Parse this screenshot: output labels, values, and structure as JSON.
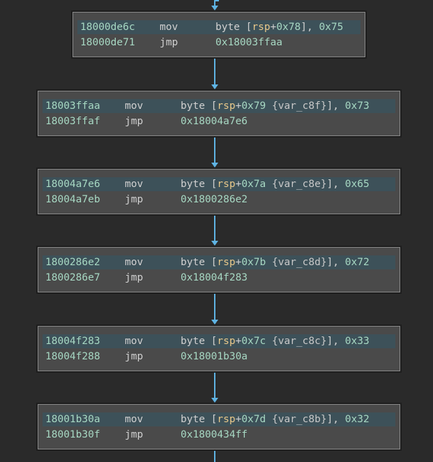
{
  "blocks": [
    {
      "rows": [
        {
          "address": "18000de6c",
          "mnemonic": "mov",
          "operands": [
            {
              "t": "byte ["
            },
            {
              "t": "rsp",
              "k": "reg"
            },
            {
              "t": "+"
            },
            {
              "t": "0x78",
              "k": "num"
            },
            {
              "t": "], "
            },
            {
              "t": "0x75",
              "k": "num"
            }
          ]
        },
        {
          "address": "18000de71",
          "mnemonic": "jmp",
          "operands": [
            {
              "t": "0x18003ffaa",
              "k": "num"
            }
          ]
        }
      ]
    },
    {
      "rows": [
        {
          "address": "18003ffaa",
          "mnemonic": "mov",
          "operands": [
            {
              "t": "byte ["
            },
            {
              "t": "rsp",
              "k": "reg"
            },
            {
              "t": "+"
            },
            {
              "t": "0x79",
              "k": "num"
            },
            {
              "t": " {var_c8f}",
              "k": "var"
            },
            {
              "t": "], "
            },
            {
              "t": "0x73",
              "k": "num"
            }
          ]
        },
        {
          "address": "18003ffaf",
          "mnemonic": "jmp",
          "operands": [
            {
              "t": "0x18004a7e6",
              "k": "num"
            }
          ]
        }
      ]
    },
    {
      "rows": [
        {
          "address": "18004a7e6",
          "mnemonic": "mov",
          "operands": [
            {
              "t": "byte ["
            },
            {
              "t": "rsp",
              "k": "reg"
            },
            {
              "t": "+"
            },
            {
              "t": "0x7a",
              "k": "num"
            },
            {
              "t": " {var_c8e}",
              "k": "var"
            },
            {
              "t": "], "
            },
            {
              "t": "0x65",
              "k": "num"
            }
          ]
        },
        {
          "address": "18004a7eb",
          "mnemonic": "jmp",
          "operands": [
            {
              "t": "0x1800286e2",
              "k": "num"
            }
          ]
        }
      ]
    },
    {
      "rows": [
        {
          "address": "1800286e2",
          "mnemonic": "mov",
          "operands": [
            {
              "t": "byte ["
            },
            {
              "t": "rsp",
              "k": "reg"
            },
            {
              "t": "+"
            },
            {
              "t": "0x7b",
              "k": "num"
            },
            {
              "t": " {var_c8d}",
              "k": "var"
            },
            {
              "t": "], "
            },
            {
              "t": "0x72",
              "k": "num"
            }
          ]
        },
        {
          "address": "1800286e7",
          "mnemonic": "jmp",
          "operands": [
            {
              "t": "0x18004f283",
              "k": "num"
            }
          ]
        }
      ]
    },
    {
      "rows": [
        {
          "address": "18004f283",
          "mnemonic": "mov",
          "operands": [
            {
              "t": "byte ["
            },
            {
              "t": "rsp",
              "k": "reg"
            },
            {
              "t": "+"
            },
            {
              "t": "0x7c",
              "k": "num"
            },
            {
              "t": " {var_c8c}",
              "k": "var"
            },
            {
              "t": "], "
            },
            {
              "t": "0x33",
              "k": "num"
            }
          ]
        },
        {
          "address": "18004f288",
          "mnemonic": "jmp",
          "operands": [
            {
              "t": "0x18001b30a",
              "k": "num"
            }
          ]
        }
      ]
    },
    {
      "rows": [
        {
          "address": "18001b30a",
          "mnemonic": "mov",
          "operands": [
            {
              "t": "byte ["
            },
            {
              "t": "rsp",
              "k": "reg"
            },
            {
              "t": "+"
            },
            {
              "t": "0x7d",
              "k": "num"
            },
            {
              "t": " {var_c8b}",
              "k": "var"
            },
            {
              "t": "], "
            },
            {
              "t": "0x32",
              "k": "num"
            }
          ]
        },
        {
          "address": "18001b30f",
          "mnemonic": "jmp",
          "operands": [
            {
              "t": "0x1800434ff",
              "k": "num"
            }
          ]
        }
      ]
    }
  ],
  "colors": {
    "background": "#2a2a2a",
    "block": "#4a4a4a",
    "highlight_row": "#3d5159",
    "address": "#a7d8c3",
    "register": "#e8c88a",
    "edge": "#5fb4e4"
  }
}
